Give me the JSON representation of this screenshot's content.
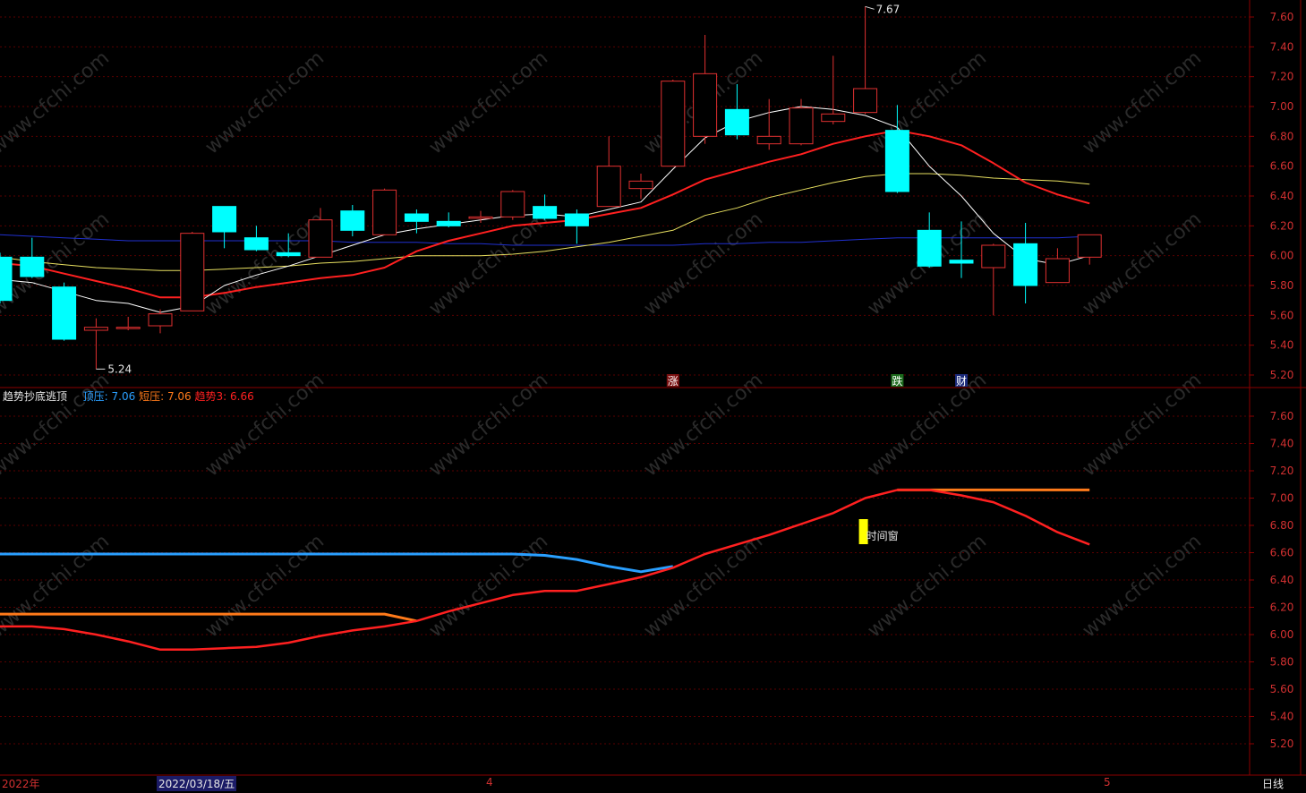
{
  "colors": {
    "background": "#000000",
    "grid": "#5a0000",
    "axis": "#8b0000",
    "axis_label": "#d03030",
    "up_candle": "#e03030",
    "down_candle": "#00ffff",
    "ma5": "#ffffff",
    "ma10": "#ff2020",
    "ma20": "#e8e060",
    "ma60": "#2030d0",
    "top_line": "#2a9fff",
    "short_line": "#ff7a1a",
    "trend_line": "#ff2020",
    "window_marker": "#ffff00"
  },
  "indicator": {
    "name": "趋势抄底逃顶",
    "top_label": "顶压:",
    "top_value": "7.06",
    "short_label": "短压:",
    "short_value": "7.06",
    "trend_label": "趋势3:",
    "trend_value": "6.66"
  },
  "bottom_axis": {
    "year_label": "2022年",
    "cursor_date": "2022/03/18/五",
    "month_apr": "4",
    "month_may": "5",
    "period_label": "日线"
  },
  "markers": {
    "high_label": "7.67",
    "low_label": "5.24",
    "event_up": "涨",
    "event_down": "跌",
    "event_finance": "财",
    "window_label": "时间窗"
  },
  "watermark": "www.cfchi.com",
  "chart_data": [
    {
      "type": "candlestick",
      "title": "",
      "ylim": [
        5.1,
        7.72
      ],
      "y_ticks": [
        "7.60",
        "7.40",
        "7.20",
        "7.00",
        "6.80",
        "6.60",
        "6.40",
        "6.20",
        "6.00",
        "5.80",
        "5.60",
        "5.40",
        "5.20"
      ],
      "candles": [
        {
          "o": 5.99,
          "c": 5.7,
          "h": 6.02,
          "l": 5.68
        },
        {
          "o": 5.99,
          "c": 5.86,
          "h": 6.12,
          "l": 5.85
        },
        {
          "o": 5.79,
          "c": 5.44,
          "h": 5.82,
          "l": 5.43
        },
        {
          "o": 5.5,
          "c": 5.52,
          "h": 5.58,
          "l": 5.24
        },
        {
          "o": 5.52,
          "c": 5.52,
          "h": 5.59,
          "l": 5.5
        },
        {
          "o": 5.53,
          "c": 5.61,
          "h": 5.64,
          "l": 5.48
        },
        {
          "o": 5.63,
          "c": 6.15,
          "h": 6.16,
          "l": 5.63
        },
        {
          "o": 6.33,
          "c": 6.16,
          "h": 6.33,
          "l": 6.05
        },
        {
          "o": 6.12,
          "c": 6.04,
          "h": 6.2,
          "l": 6.03
        },
        {
          "o": 6.02,
          "c": 6.0,
          "h": 6.15,
          "l": 5.99
        },
        {
          "o": 5.99,
          "c": 6.24,
          "h": 6.32,
          "l": 5.99
        },
        {
          "o": 6.3,
          "c": 6.17,
          "h": 6.34,
          "l": 6.13
        },
        {
          "o": 6.14,
          "c": 6.44,
          "h": 6.45,
          "l": 6.14
        },
        {
          "o": 6.28,
          "c": 6.23,
          "h": 6.31,
          "l": 6.15
        },
        {
          "o": 6.23,
          "c": 6.2,
          "h": 6.29,
          "l": 6.19
        },
        {
          "o": 6.25,
          "c": 6.26,
          "h": 6.3,
          "l": 6.22
        },
        {
          "o": 6.26,
          "c": 6.43,
          "h": 6.44,
          "l": 6.24
        },
        {
          "o": 6.33,
          "c": 6.25,
          "h": 6.41,
          "l": 6.24
        },
        {
          "o": 6.28,
          "c": 6.2,
          "h": 6.31,
          "l": 6.08
        },
        {
          "o": 6.33,
          "c": 6.6,
          "h": 6.8,
          "l": 6.33
        },
        {
          "o": 6.45,
          "c": 6.5,
          "h": 6.55,
          "l": 6.38
        },
        {
          "o": 6.6,
          "c": 7.17,
          "h": 7.18,
          "l": 6.6
        },
        {
          "o": 6.8,
          "c": 7.22,
          "h": 7.48,
          "l": 6.75
        },
        {
          "o": 6.98,
          "c": 6.81,
          "h": 7.15,
          "l": 6.78
        },
        {
          "o": 6.75,
          "c": 6.8,
          "h": 7.05,
          "l": 6.71
        },
        {
          "o": 6.75,
          "c": 6.99,
          "h": 7.05,
          "l": 6.74
        },
        {
          "o": 6.9,
          "c": 6.95,
          "h": 7.34,
          "l": 6.88
        },
        {
          "o": 6.96,
          "c": 7.12,
          "h": 7.67,
          "l": 6.95
        },
        {
          "o": 6.84,
          "c": 6.43,
          "h": 7.01,
          "l": 6.42
        },
        {
          "o": 6.17,
          "c": 5.93,
          "h": 6.29,
          "l": 5.92
        },
        {
          "o": 5.97,
          "c": 5.95,
          "h": 6.23,
          "l": 5.85
        },
        {
          "o": 5.92,
          "c": 6.07,
          "h": 6.08,
          "l": 5.6
        },
        {
          "o": 6.08,
          "c": 5.8,
          "h": 6.22,
          "l": 5.68
        },
        {
          "o": 5.82,
          "c": 5.98,
          "h": 6.05,
          "l": 5.82
        },
        {
          "o": 5.99,
          "c": 6.14,
          "h": 6.14,
          "l": 5.94
        }
      ],
      "ma5": [
        5.84,
        5.82,
        5.76,
        5.7,
        5.68,
        5.62,
        5.66,
        5.8,
        5.87,
        5.93,
        6.0,
        6.07,
        6.14,
        6.18,
        6.21,
        6.24,
        6.27,
        6.28,
        6.26,
        6.31,
        6.36,
        6.58,
        6.79,
        6.9,
        6.96,
        7.0,
        6.98,
        6.94,
        6.86,
        6.6,
        6.4,
        6.15,
        5.98,
        5.94,
        6.0
      ],
      "ma10": [
        5.95,
        5.93,
        5.88,
        5.83,
        5.78,
        5.72,
        5.72,
        5.75,
        5.79,
        5.82,
        5.85,
        5.87,
        5.92,
        6.03,
        6.1,
        6.15,
        6.2,
        6.22,
        6.24,
        6.28,
        6.32,
        6.41,
        6.51,
        6.57,
        6.63,
        6.68,
        6.75,
        6.8,
        6.84,
        6.8,
        6.74,
        6.62,
        6.49,
        6.41,
        6.35
      ],
      "ma20": [
        5.99,
        5.96,
        5.94,
        5.92,
        5.91,
        5.9,
        5.9,
        5.91,
        5.92,
        5.93,
        5.95,
        5.96,
        5.98,
        6.0,
        6.0,
        6.0,
        6.01,
        6.03,
        6.06,
        6.09,
        6.13,
        6.17,
        6.27,
        6.32,
        6.39,
        6.44,
        6.49,
        6.53,
        6.55,
        6.55,
        6.54,
        6.52,
        6.51,
        6.5,
        6.48
      ],
      "ma60": [
        6.14,
        6.13,
        6.12,
        6.11,
        6.1,
        6.1,
        6.1,
        6.1,
        6.1,
        6.1,
        6.1,
        6.09,
        6.09,
        6.09,
        6.08,
        6.08,
        6.07,
        6.07,
        6.07,
        6.07,
        6.07,
        6.07,
        6.08,
        6.08,
        6.09,
        6.09,
        6.1,
        6.11,
        6.12,
        6.12,
        6.12,
        6.12,
        6.12,
        6.12,
        6.13
      ]
    },
    {
      "type": "line",
      "title": "",
      "ylim": [
        5.1,
        7.72
      ],
      "y_ticks": [
        "7.60",
        "7.40",
        "7.20",
        "7.00",
        "6.80",
        "6.60",
        "6.40",
        "6.20",
        "6.00",
        "5.80",
        "5.60",
        "5.40",
        "5.20"
      ],
      "series": [
        {
          "name": "顶压",
          "values": [
            6.59,
            6.59,
            6.59,
            6.59,
            6.59,
            6.59,
            6.59,
            6.59,
            6.59,
            6.59,
            6.59,
            6.59,
            6.59,
            6.59,
            6.59,
            6.59,
            6.59,
            6.58,
            6.55,
            6.5,
            6.46,
            6.5,
            null,
            null,
            null,
            null,
            null,
            null,
            null,
            null,
            null,
            null,
            null,
            null,
            null
          ]
        },
        {
          "name": "短压",
          "values": [
            6.15,
            6.15,
            6.15,
            6.15,
            6.15,
            6.15,
            6.15,
            6.15,
            6.15,
            6.15,
            6.15,
            6.15,
            6.15,
            6.1,
            null,
            null,
            null,
            null,
            null,
            null,
            null,
            null,
            null,
            null,
            null,
            null,
            null,
            null,
            7.06,
            7.06,
            7.06,
            7.06,
            7.06,
            7.06,
            7.06
          ]
        },
        {
          "name": "趋势3",
          "values": [
            6.06,
            6.06,
            6.04,
            6.0,
            5.95,
            5.89,
            5.89,
            5.9,
            5.91,
            5.94,
            5.99,
            6.03,
            6.06,
            6.1,
            6.17,
            6.23,
            6.29,
            6.32,
            6.32,
            6.37,
            6.42,
            6.49,
            6.59,
            6.66,
            6.73,
            6.81,
            6.89,
            7.0,
            7.06,
            7.06,
            7.02,
            6.97,
            6.87,
            6.75,
            6.66
          ]
        }
      ]
    }
  ]
}
